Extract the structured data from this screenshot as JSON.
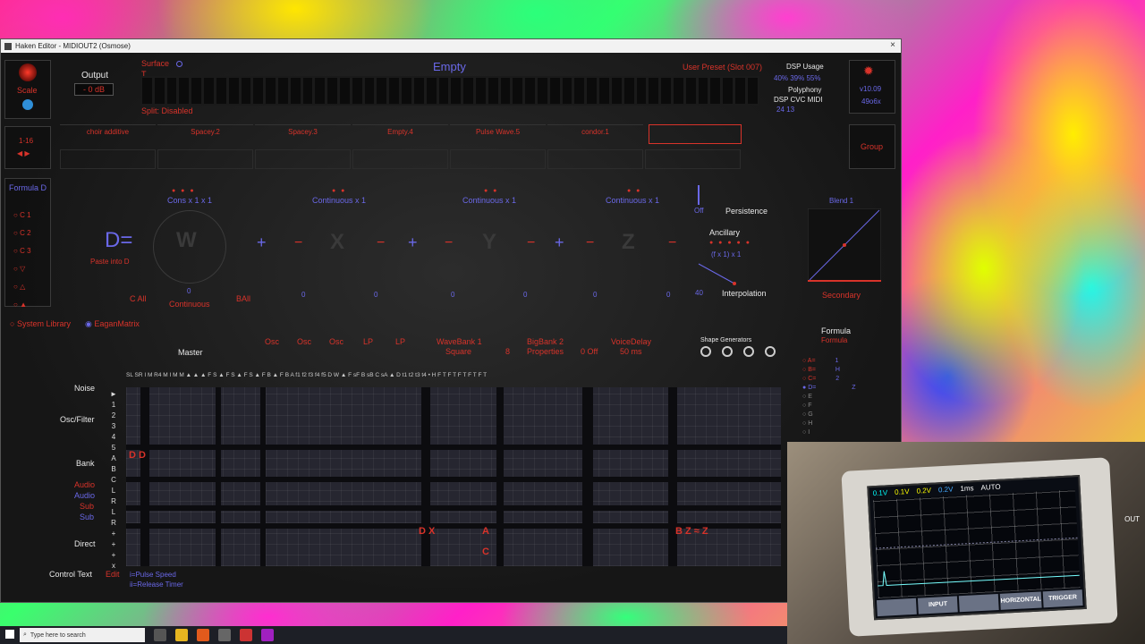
{
  "window": {
    "title": "Haken Editor - MIDIOUT2 (Osmose)",
    "close": "×"
  },
  "left": {
    "scale": "Scale",
    "output_label": "Output",
    "output_value": "- 0 dB",
    "channels": "1-16",
    "arrows": "◀ ▶"
  },
  "surface": {
    "label": "Surface",
    "t": "T",
    "split": "Split: Disabled"
  },
  "preset": {
    "name": "Empty",
    "user_preset": "User Preset (Slot 007)"
  },
  "dsp": {
    "title": "DSP Usage",
    "values": "40%  39%  55%",
    "poly_title": "Polyphony",
    "cols": "DSP   CVC   MIDI",
    "nums": "24                13"
  },
  "version": {
    "v": "v10.09",
    "build": "49o6x"
  },
  "slots": [
    "choir additive",
    "Spacey.2",
    "Spacey.3",
    "Empty.4",
    "Pulse Wave.5",
    "condor.1",
    ""
  ],
  "group_label": "Group",
  "formula": {
    "panel_title": "Formula D",
    "items": [
      "C 1",
      "C 2",
      "C 3",
      "▽",
      "△",
      "▲"
    ],
    "d_eq": "D=",
    "paste": "Paste into D",
    "w": "W",
    "x": "X",
    "y": "Y",
    "z": "Z",
    "ops": [
      "+",
      "−",
      "−",
      "+",
      "−",
      "−",
      "+",
      "−",
      "−"
    ],
    "cons": "Cons x 1 x 1",
    "cont1": "Continuous x 1",
    "cont2": "Continuous x 1",
    "cont3": "Continuous x 1",
    "off": "Off",
    "persistence": "Persistence",
    "ancillary": "Ancillary",
    "fx": "(f x 1) x 1",
    "interpolation": "Interpolation",
    "blend": "Blend 1",
    "secondary": "Secondary",
    "c_all": "C All",
    "b_all": "BAll",
    "continuous": "Continuous",
    "zeros": [
      "0",
      "0",
      "0",
      "0",
      "0",
      "0",
      "0",
      "40"
    ]
  },
  "library": {
    "system": "System Library",
    "eagan": "EaganMatrix"
  },
  "matrix": {
    "master": "Master",
    "headers": [
      "Osc",
      "Osc",
      "Osc",
      "LP",
      "LP",
      "WaveBank 1",
      "BigBank 2",
      "VoiceDelay",
      "Shape Generators"
    ],
    "subheaders": [
      "Square",
      "Properties",
      "50 ms"
    ],
    "off": "0  Off",
    "eight": "8",
    "col_letters": "SL SR  I  M R4 M  I  M  M  ▲ ▲  ▲ F S ▲ F S ▲ F S ▲ F B ▲ F B  A f1 f2 f3 f4 f5 D W  ▲ F sF B sB C sA  ▲ D t1 t2 t3 t4 • H  F T F T F T F T F T",
    "row_labels": [
      "►",
      "1",
      "2",
      "3",
      "4",
      "5",
      "A",
      "B",
      "C",
      "L",
      "R",
      "L",
      "R",
      "+",
      "+",
      "+",
      "x"
    ],
    "side_labels": {
      "noise": "Noise",
      "osc": "Osc/Filter",
      "bank": "Bank",
      "audio1": "Audio",
      "audio2": "Audio",
      "sub1": "Sub",
      "sub2": "Sub",
      "direct": "Direct",
      "control": "Control Text",
      "edit": "Edit"
    },
    "control_text": [
      "i=Pulse Speed",
      "ii=Release Timer"
    ],
    "marks": {
      "dd": "D D",
      "dx": "D X",
      "a": "A",
      "c": "C",
      "bz": "B Z ≈ Z"
    }
  },
  "formula_side": {
    "title": "Formula",
    "sub": "Formula",
    "rows": [
      "A=",
      "B=",
      "C=",
      "D=",
      "E",
      "F",
      "G",
      "H",
      "I"
    ],
    "vals": [
      "1",
      "H",
      "2",
      "",
      "Z"
    ]
  },
  "scope": {
    "top": [
      "0.1V",
      "0.1V",
      "0.2V",
      "0.2V",
      "1ms",
      "AUTO"
    ],
    "buttons": [
      "",
      "INPUT",
      "",
      "HORIZONTAL",
      "TRIGGER"
    ],
    "out": "OUT"
  },
  "taskbar": {
    "search": "Type here to search"
  }
}
